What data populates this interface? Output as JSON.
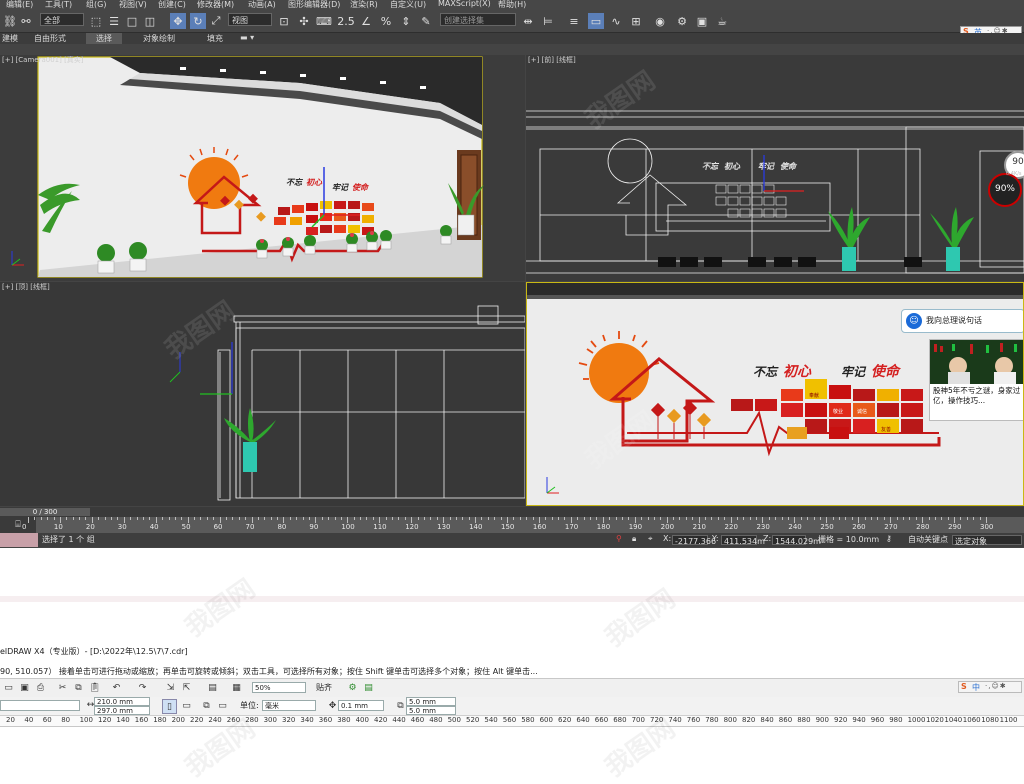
{
  "menubar": [
    "编辑(E)",
    "工具(T)",
    "组(G)",
    "视图(V)",
    "创建(C)",
    "修改器(M)",
    "动画(A)",
    "图形编辑器(D)",
    "渲染(R)",
    "自定义(U)",
    "MAXScript(X)",
    "帮助(H)"
  ],
  "toolbar": {
    "selection_filter": "全部",
    "ref_coord": "视图",
    "named_sel": "创建选择集",
    "ime_label": "英"
  },
  "ribbon": [
    "建模",
    "自由形式",
    "选择",
    "对象绘制",
    "填充"
  ],
  "viewports": {
    "camera": {
      "label": "[+] [Camera001] [真实]"
    },
    "front": {
      "label": "[+] [前] [线框]"
    },
    "top": {
      "label": "[+] [顶] [线框]"
    },
    "perspective": {
      "label": ""
    }
  },
  "scene": {
    "slogan_a": "不忘",
    "slogan_b": "初心",
    "slogan_c": "牢记",
    "slogan_d": "使命",
    "badge1": "90",
    "badge2": "90%",
    "badge_sub": "0.4K/s",
    "box_words": [
      "奉献",
      "敬业",
      "诚信",
      "友善"
    ]
  },
  "chat_popup": {
    "title": "我向总理说句话",
    "message": "股神5年不亏之谜，身家过亿，操作技巧..."
  },
  "timeline": {
    "frame_label": "0 / 300",
    "ticks": [
      "0",
      "10",
      "20",
      "30",
      "40",
      "50",
      "60",
      "70",
      "80",
      "90",
      "100",
      "110",
      "120",
      "130",
      "140",
      "150",
      "160",
      "170",
      "180",
      "190",
      "200",
      "210",
      "220",
      "230",
      "240",
      "250",
      "260",
      "270",
      "280",
      "290",
      "300"
    ]
  },
  "status": {
    "message": "选择了 1 个 组",
    "x_label": "X:",
    "x": "-2177.366",
    "y_label": "Y:",
    "y": "411.534m",
    "z_label": "Z:",
    "z": "1544.029m",
    "grid": "栅格 = 10.0mm",
    "autokey": "自动关键点",
    "selected": "选定对象"
  },
  "corel": {
    "title": "elDRAW X4（专业版）- [D:\\2022年\\12.5\\7\\7.cdr]",
    "hint": "90, 510.057）  接着单击可进行拖动或缩放；再单击可旋转或倾斜；双击工具，可选择所有对象；按住 Shift 键单击可选择多个对象；按住 Alt 键单击...",
    "zoom": "50%",
    "snap": "贴齐",
    "width": "210.0 mm",
    "height": "297.0 mm",
    "unit_label": "单位:",
    "unit": "毫米",
    "nudge": "0.1 mm",
    "dup1": "5.0 mm",
    "dup2": "5.0 mm",
    "ime": "中",
    "ruler": [
      "20",
      "40",
      "60",
      "80",
      "100",
      "120",
      "140",
      "160",
      "180",
      "200",
      "220",
      "240",
      "260",
      "280",
      "300",
      "320",
      "340",
      "360",
      "380",
      "400",
      "420",
      "440",
      "460",
      "480",
      "500",
      "520",
      "540",
      "560",
      "580",
      "600",
      "620",
      "640",
      "660",
      "680",
      "700",
      "720",
      "740",
      "760",
      "780",
      "800",
      "820",
      "840",
      "860",
      "880",
      "900",
      "920",
      "940",
      "960",
      "980",
      "1000",
      "1020",
      "1040",
      "1060",
      "1080",
      "1100"
    ]
  },
  "watermark": "我图网"
}
